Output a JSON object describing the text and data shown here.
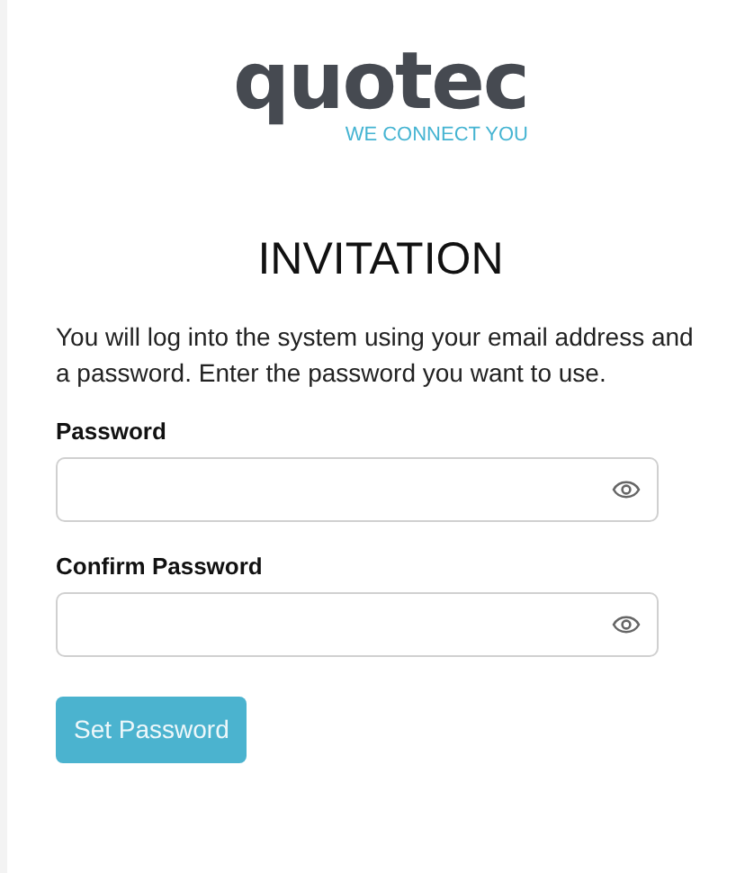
{
  "logo": {
    "wordmark": "quotec",
    "tagline": "WE CONNECT YOU"
  },
  "title": "INVITATION",
  "description": "You will log into the system using your email address and a password. Enter the password you want to use.",
  "fields": [
    {
      "label": "Password"
    },
    {
      "label": "Confirm Password"
    }
  ],
  "button": {
    "label": "Set Password"
  }
}
